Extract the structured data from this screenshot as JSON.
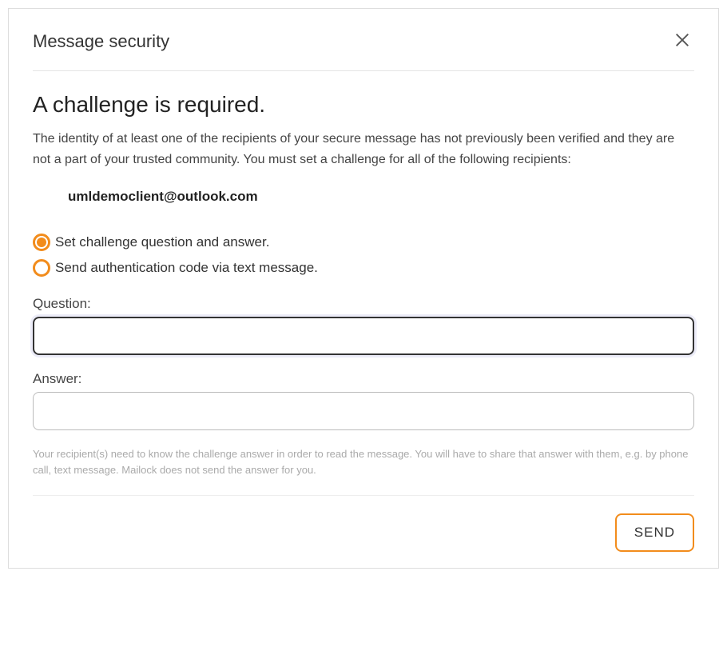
{
  "dialog": {
    "title": "Message security",
    "heading": "A challenge is required.",
    "description": "The identity of at least one of the recipients of your secure message has not previously been verified and they are not a part of your trusted community. You must set a challenge for all of the following recipients:",
    "recipient": "umldemoclient@outlook.com",
    "radio_options": {
      "option1": "Set challenge question and answer.",
      "option2": "Send authentication code via text message."
    },
    "fields": {
      "question_label": "Question:",
      "question_value": "",
      "answer_label": "Answer:",
      "answer_value": ""
    },
    "hint": "Your recipient(s) need to know the challenge answer in order to read the message. You will have to share that answer with them, e.g. by phone call, text message. Mailock does not send the answer for you.",
    "send_button": "SEND"
  },
  "colors": {
    "accent": "#f28c1c"
  }
}
